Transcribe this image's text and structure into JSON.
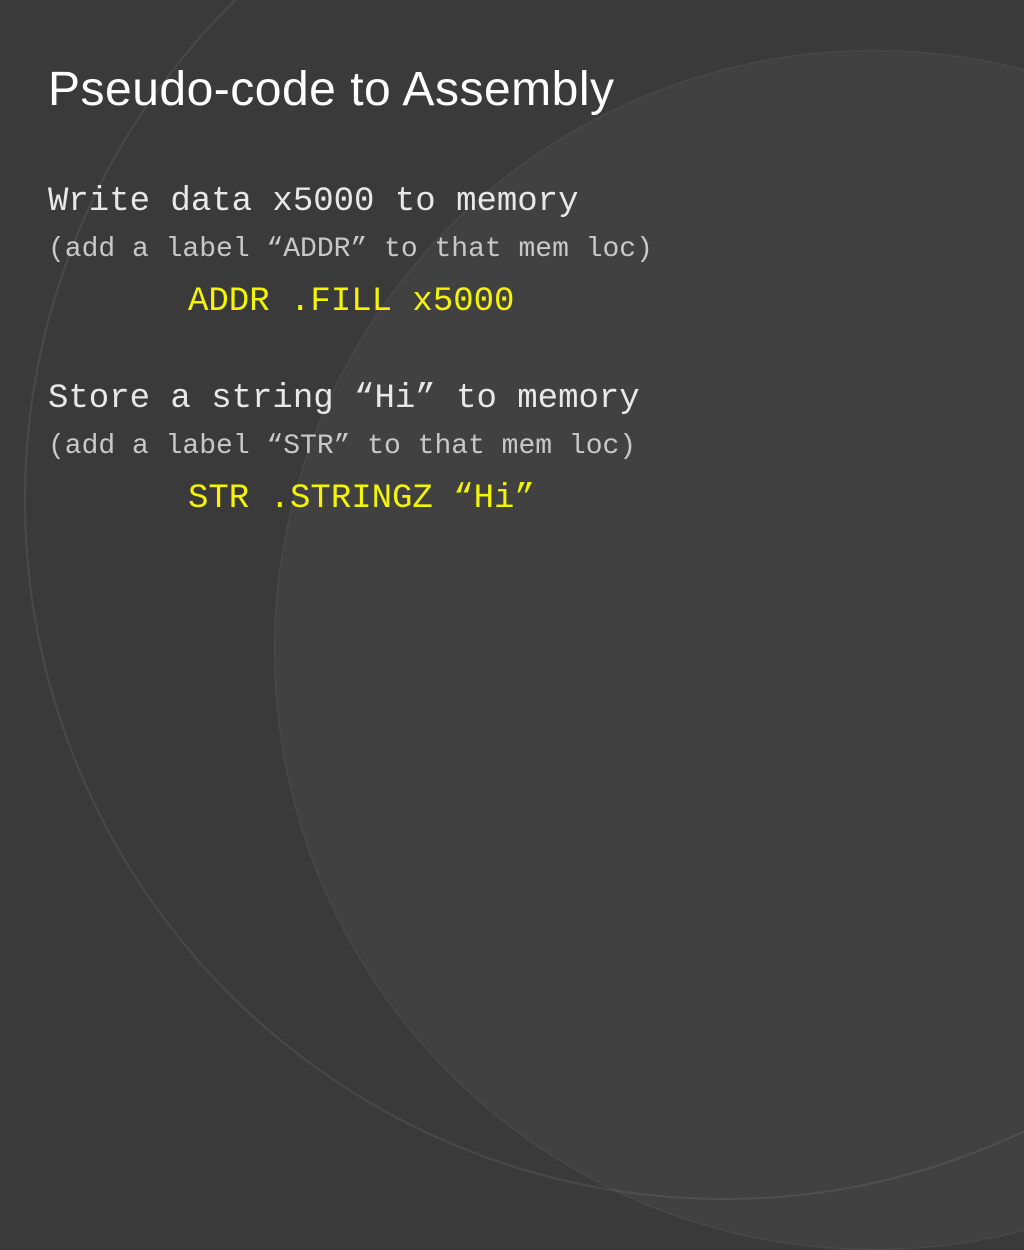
{
  "title": "Pseudo-code to Assembly",
  "block1": {
    "main": "Write data x5000 to memory",
    "sub": "(add a label “ADDR” to that mem loc)",
    "code": "ADDR .FILL x5000"
  },
  "block2": {
    "main": "Store a string “Hi” to memory",
    "sub": "(add a label “STR” to that mem loc)",
    "code": "STR .STRINGZ “Hi”"
  }
}
